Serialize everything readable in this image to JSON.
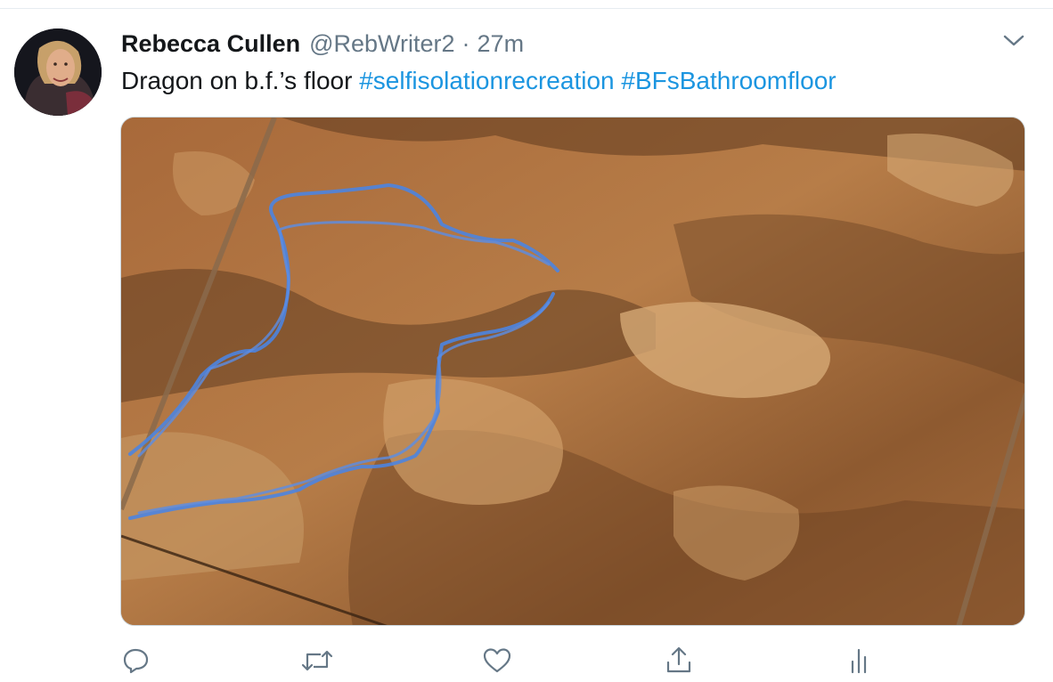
{
  "tweet": {
    "display_name": "Rebecca Cullen",
    "handle": "@RebWriter2",
    "separator": "·",
    "time": "27m",
    "text_prefix": "Dragon on b.f.’s floor ",
    "hashtags": [
      "#selfisolationrecreation",
      "#BFsBathroomfloor"
    ]
  },
  "icons": {
    "more": "chevron-down-icon",
    "reply": "reply-icon",
    "retweet": "retweet-icon",
    "like": "heart-icon",
    "share": "share-icon",
    "analytics": "analytics-icon"
  },
  "colors": {
    "text": "#14171a",
    "secondary": "#657786",
    "link": "#1b95e0",
    "drawing": "#4d84e0"
  }
}
